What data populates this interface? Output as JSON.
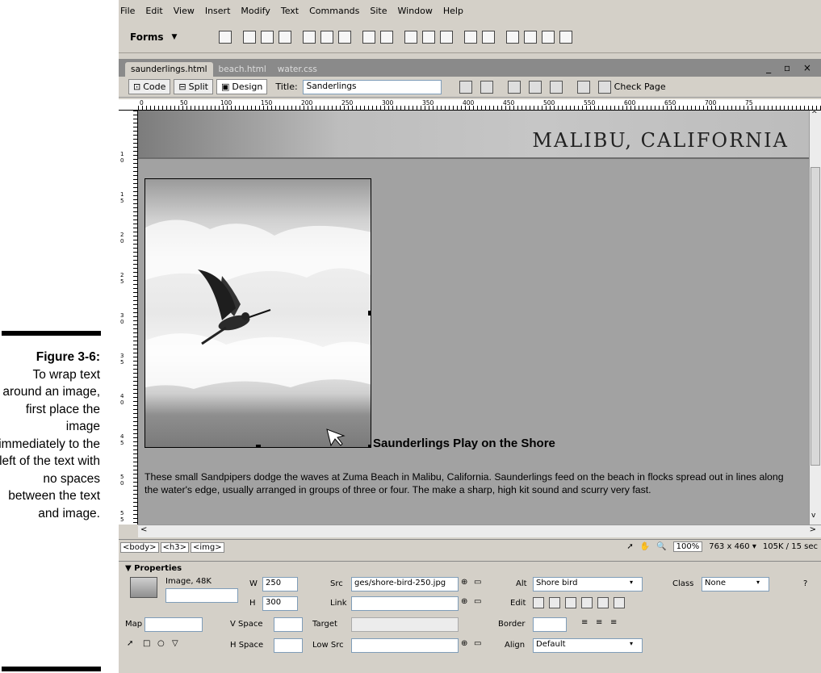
{
  "caption": {
    "label": "Figure 3-6:",
    "text": "To wrap text around an image, first place the image immediately to the left of the text with no spaces between the text and image."
  },
  "menu": [
    "File",
    "Edit",
    "View",
    "Insert",
    "Modify",
    "Text",
    "Commands",
    "Site",
    "Window",
    "Help"
  ],
  "insert_bar": {
    "category": "Forms",
    "category_arrow": "▼"
  },
  "tabs": [
    "saunderlings.html",
    "beach.html",
    "water.css"
  ],
  "window_buttons": "_ ▫ ×",
  "doc_toolbar": {
    "code": "Code",
    "split": "Split",
    "design": "Design",
    "title_label": "Title:",
    "title_value": "Sanderlings",
    "check_page": "Check Page"
  },
  "ruler_ticks": [
    "0",
    "50",
    "100",
    "150",
    "200",
    "250",
    "300",
    "350",
    "400",
    "450",
    "500",
    "550",
    "600",
    "650",
    "700",
    "75"
  ],
  "vruler_ticks": [
    "1 0",
    "1 5",
    "2 0",
    "2 5",
    "3 0",
    "3 5",
    "4 0",
    "4 5",
    "5 0",
    "5 5"
  ],
  "page": {
    "banner": "MALIBU, CALIFORNIA",
    "heading": "Saunderlings Play on the Shore",
    "paragraph": "These small Sandpipers dodge the waves at Zuma Beach in Malibu, California. Saunderlings feed on the beach in flocks spread out in lines along the water's edge, usually arranged in groups of three or four. The make a sharp, high kit sound and scurry very fast."
  },
  "status": {
    "tags": [
      "<body>",
      "<h3>",
      "<img>"
    ],
    "zoom": "100%",
    "size": "763 x 460 ▾",
    "download": "105K / 15 sec"
  },
  "properties": {
    "title": "▼ Properties",
    "kind": "Image, 48K",
    "w_label": "W",
    "w": "250",
    "h_label": "H",
    "h": "300",
    "src_label": "Src",
    "src": "ges/shore-bird-250.jpg",
    "link_label": "Link",
    "link": "",
    "alt_label": "Alt",
    "alt": "Shore bird",
    "class_label": "Class",
    "class": "None",
    "edit_label": "Edit",
    "map_label": "Map",
    "vspace_label": "V Space",
    "target_label": "Target",
    "border_label": "Border",
    "hspace_label": "H Space",
    "lowsrc_label": "Low Src",
    "align_label": "Align",
    "align": "Default"
  }
}
